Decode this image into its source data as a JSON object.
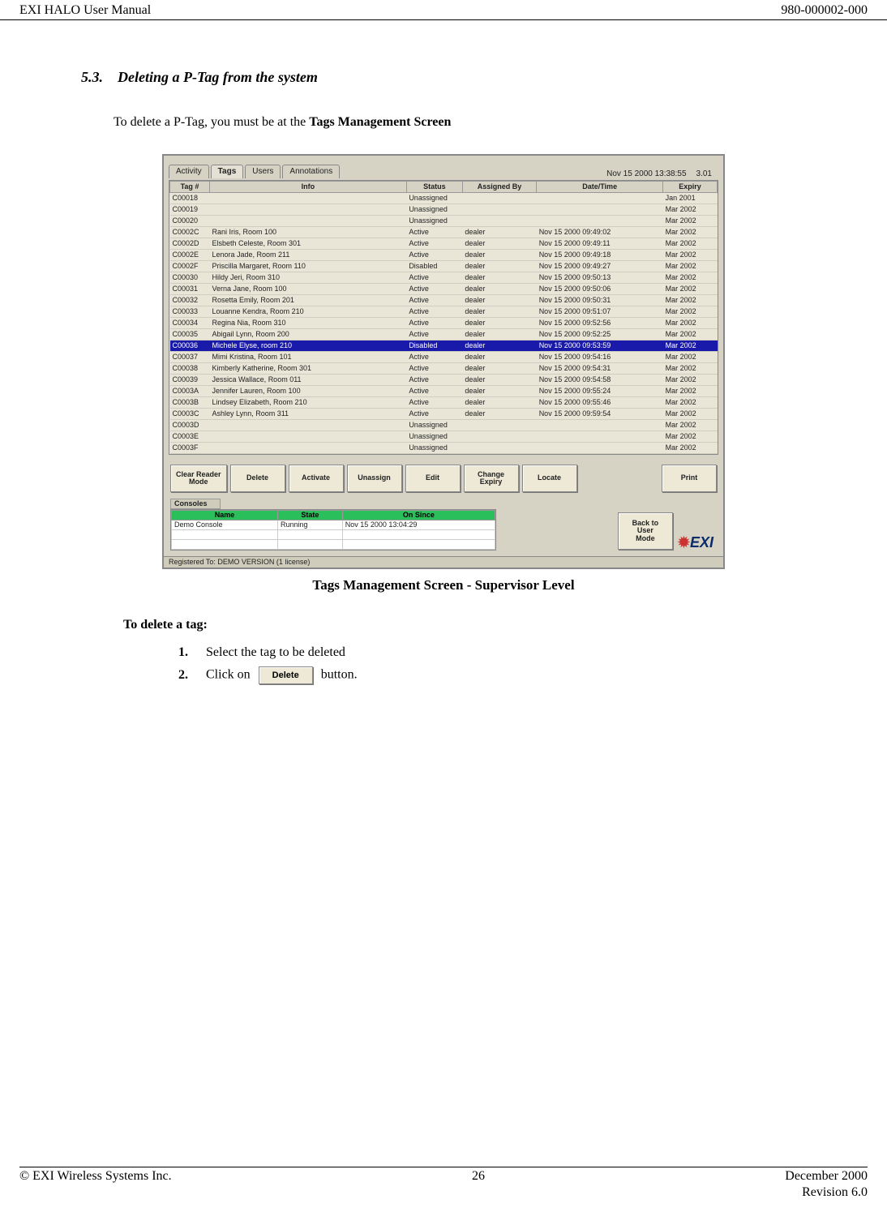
{
  "header": {
    "left": "EXI HALO User Manual",
    "right": "980-000002-000"
  },
  "section": {
    "number": "5.3.",
    "title": "Deleting a P-Tag from the system",
    "intro_prefix": "To delete a P-Tag, you must be at the ",
    "intro_bold": "Tags Management Screen"
  },
  "app": {
    "tabs": [
      "Activity",
      "Tags",
      "Users",
      "Annotations"
    ],
    "active_tab_index": 1,
    "clock": "Nov 15 2000  13:38:55",
    "version": "3.01",
    "columns": [
      "Tag #",
      "Info",
      "Status",
      "Assigned By",
      "Date/Time",
      "Expiry"
    ],
    "rows": [
      {
        "tag": "C00018",
        "info": "",
        "status": "Unassigned",
        "by": "",
        "dt": "",
        "exp": "Jan 2001"
      },
      {
        "tag": "C00019",
        "info": "",
        "status": "Unassigned",
        "by": "",
        "dt": "",
        "exp": "Mar 2002"
      },
      {
        "tag": "C00020",
        "info": "",
        "status": "Unassigned",
        "by": "",
        "dt": "",
        "exp": "Mar 2002"
      },
      {
        "tag": "C0002C",
        "info": "Rani Iris, Room 100",
        "status": "Active",
        "by": "dealer",
        "dt": "Nov 15 2000  09:49:02",
        "exp": "Mar 2002"
      },
      {
        "tag": "C0002D",
        "info": "Elsbeth Celeste, Room 301",
        "status": "Active",
        "by": "dealer",
        "dt": "Nov 15 2000  09:49:11",
        "exp": "Mar 2002"
      },
      {
        "tag": "C0002E",
        "info": "Lenora Jade, Room 211",
        "status": "Active",
        "by": "dealer",
        "dt": "Nov 15 2000  09:49:18",
        "exp": "Mar 2002"
      },
      {
        "tag": "C0002F",
        "info": "Priscilla Margaret, Room 110",
        "status": "Disabled",
        "by": "dealer",
        "dt": "Nov 15 2000  09:49:27",
        "exp": "Mar 2002"
      },
      {
        "tag": "C00030",
        "info": "Hildy Jeri, Room 310",
        "status": "Active",
        "by": "dealer",
        "dt": "Nov 15 2000  09:50:13",
        "exp": "Mar 2002"
      },
      {
        "tag": "C00031",
        "info": "Verna Jane, Room 100",
        "status": "Active",
        "by": "dealer",
        "dt": "Nov 15 2000  09:50:06",
        "exp": "Mar 2002"
      },
      {
        "tag": "C00032",
        "info": "Rosetta Emily, Room 201",
        "status": "Active",
        "by": "dealer",
        "dt": "Nov 15 2000  09:50:31",
        "exp": "Mar 2002"
      },
      {
        "tag": "C00033",
        "info": "Louanne Kendra, Room 210",
        "status": "Active",
        "by": "dealer",
        "dt": "Nov 15 2000  09:51:07",
        "exp": "Mar 2002"
      },
      {
        "tag": "C00034",
        "info": "Regina Nia, Room 310",
        "status": "Active",
        "by": "dealer",
        "dt": "Nov 15 2000  09:52:56",
        "exp": "Mar 2002"
      },
      {
        "tag": "C00035",
        "info": "Abigail Lynn, Room 200",
        "status": "Active",
        "by": "dealer",
        "dt": "Nov 15 2000  09:52:25",
        "exp": "Mar 2002"
      },
      {
        "tag": "C00036",
        "info": "Michele Elyse, room 210",
        "status": "Disabled",
        "by": "dealer",
        "dt": "Nov 15 2000  09:53:59",
        "exp": "Mar 2002",
        "selected": true
      },
      {
        "tag": "C00037",
        "info": "Mimi Kristina, Room 101",
        "status": "Active",
        "by": "dealer",
        "dt": "Nov 15 2000  09:54:16",
        "exp": "Mar 2002"
      },
      {
        "tag": "C00038",
        "info": "Kimberly Katherine, Room 301",
        "status": "Active",
        "by": "dealer",
        "dt": "Nov 15 2000  09:54:31",
        "exp": "Mar 2002"
      },
      {
        "tag": "C00039",
        "info": "Jessica Wallace, Room 011",
        "status": "Active",
        "by": "dealer",
        "dt": "Nov 15 2000  09:54:58",
        "exp": "Mar 2002"
      },
      {
        "tag": "C0003A",
        "info": "Jennifer Lauren, Room 100",
        "status": "Active",
        "by": "dealer",
        "dt": "Nov 15 2000  09:55:24",
        "exp": "Mar 2002"
      },
      {
        "tag": "C0003B",
        "info": "Lindsey Elizabeth, Room 210",
        "status": "Active",
        "by": "dealer",
        "dt": "Nov 15 2000  09:55:46",
        "exp": "Mar 2002"
      },
      {
        "tag": "C0003C",
        "info": "Ashley Lynn, Room 311",
        "status": "Active",
        "by": "dealer",
        "dt": "Nov 15 2000  09:59:54",
        "exp": "Mar 2002"
      },
      {
        "tag": "C0003D",
        "info": "",
        "status": "Unassigned",
        "by": "",
        "dt": "",
        "exp": "Mar 2002"
      },
      {
        "tag": "C0003E",
        "info": "",
        "status": "Unassigned",
        "by": "",
        "dt": "",
        "exp": "Mar 2002"
      },
      {
        "tag": "C0003F",
        "info": "",
        "status": "Unassigned",
        "by": "",
        "dt": "",
        "exp": "Mar 2002"
      }
    ],
    "buttons": {
      "clear_reader": "Clear Reader\nMode",
      "delete": "Delete",
      "activate": "Activate",
      "unassign": "Unassign",
      "edit": "Edit",
      "change_expiry": "Change\nExpiry",
      "locate": "Locate",
      "print": "Print",
      "back_to_user": "Back to\nUser\nMode"
    },
    "consoles": {
      "label": "Consoles",
      "headers": [
        "Name",
        "State",
        "On Since"
      ],
      "rows": [
        {
          "name": "Demo Console",
          "state": "Running",
          "since": "Nov 15 2000  13:04:29"
        }
      ]
    },
    "registered": "Registered To:   DEMO VERSION (1 license)",
    "logo_text": "EXI"
  },
  "caption": "Tags Management Screen - Supervisor Level",
  "steps": {
    "heading": "To delete a tag:",
    "items": [
      {
        "n": "1.",
        "text": "Select the tag to be deleted"
      },
      {
        "n": "2.",
        "prefix": "Click on ",
        "button": "Delete",
        "suffix": " button."
      }
    ]
  },
  "footer": {
    "left": "© EXI Wireless Systems Inc.",
    "center": "26",
    "right1": "December 2000",
    "right2": "Revision 6.0"
  }
}
